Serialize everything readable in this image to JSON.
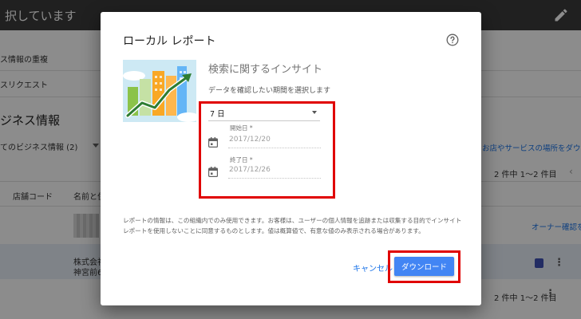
{
  "background": {
    "header_title": "択しています",
    "nav_items": [
      "ス情報の重複",
      "スリクエスト"
    ],
    "heading": "ジネス情報",
    "filter_label": "てのビジネス情報 (2)",
    "link_services": "お店やサービスの場所をダウンロ",
    "pager": "2 件中 1〜2 件目",
    "columns": {
      "store_code": "店舗コード",
      "name_address": "名前と住"
    },
    "owner_link": "オーナー確認を",
    "row_company": "株式会社",
    "row_address": "神宮前6-"
  },
  "dialog": {
    "title": "ローカル レポート",
    "insight_title": "検索に関するインサイト",
    "insight_subtitle": "データを確認したい期間を選択します",
    "period": {
      "value": "7 日"
    },
    "start_date": {
      "label": "開始日 *",
      "value": "2017/12/20"
    },
    "end_date": {
      "label": "終了日 *",
      "value": "2017/12/26"
    },
    "notice": "レポートの情報は、この組織内でのみ使用できます。お客様は、ユーザーの個人情報を追跡または収集する目的でインサイト レポートを使用しないことに同意するものとします。値は概算値で、有意な値のみ表示される場合があります。",
    "cancel_label": "キャンセル",
    "download_label": "ダウンロード"
  },
  "icons": {
    "edit": "pencil-icon",
    "help": "help-circle-icon",
    "calendar": "calendar-icon",
    "menu": "more-vert-icon"
  },
  "colors": {
    "accent": "#4285f4",
    "highlight": "#e00000",
    "topbar": "#3b3b3b"
  }
}
